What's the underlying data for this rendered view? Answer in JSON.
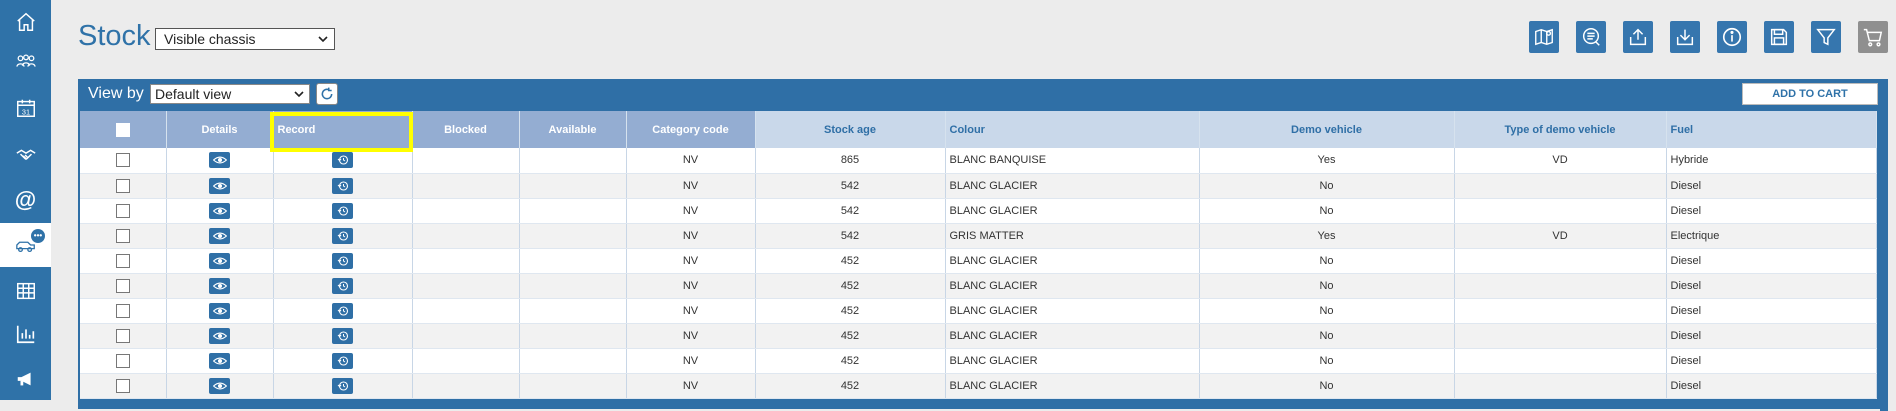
{
  "nav": {
    "items": [
      {
        "name": "home-icon"
      },
      {
        "name": "group-icon"
      },
      {
        "name": "calendar-icon",
        "text": "31"
      },
      {
        "name": "handshake-icon"
      },
      {
        "name": "at-icon",
        "text": "@"
      },
      {
        "name": "vehicles-icon",
        "badge": "•••",
        "active": true
      },
      {
        "name": "spreadsheet-icon"
      },
      {
        "name": "bar-chart-icon"
      },
      {
        "name": "megaphone-icon"
      }
    ]
  },
  "header": {
    "title": "Stock",
    "chassis_select": "Visible chassis"
  },
  "toolbar": [
    "map-pin-icon",
    "search-list-icon",
    "upload-icon",
    "download-icon",
    "info-icon",
    "save-icon",
    "filter-icon",
    "cart-icon"
  ],
  "panel": {
    "viewby_label": "View by",
    "viewby_select": "Default view",
    "add_to_cart": "ADD TO CART"
  },
  "table": {
    "columns": [
      "",
      "Details",
      "Record",
      "Blocked",
      "Available",
      "Category code",
      "Stock age",
      "Colour",
      "Demo vehicle",
      "Type of demo vehicle",
      "Fuel"
    ],
    "rows": [
      {
        "category": "NV",
        "age": "865",
        "colour": "BLANC BANQUISE",
        "demo": "Yes",
        "demo_type": "VD",
        "fuel": "Hybride"
      },
      {
        "category": "NV",
        "age": "542",
        "colour": "BLANC GLACIER",
        "demo": "No",
        "demo_type": "",
        "fuel": "Diesel"
      },
      {
        "category": "NV",
        "age": "542",
        "colour": "BLANC GLACIER",
        "demo": "No",
        "demo_type": "",
        "fuel": "Diesel"
      },
      {
        "category": "NV",
        "age": "542",
        "colour": "GRIS MATTER",
        "demo": "Yes",
        "demo_type": "VD",
        "fuel": "Electrique"
      },
      {
        "category": "NV",
        "age": "452",
        "colour": "BLANC GLACIER",
        "demo": "No",
        "demo_type": "",
        "fuel": "Diesel"
      },
      {
        "category": "NV",
        "age": "452",
        "colour": "BLANC GLACIER",
        "demo": "No",
        "demo_type": "",
        "fuel": "Diesel"
      },
      {
        "category": "NV",
        "age": "452",
        "colour": "BLANC GLACIER",
        "demo": "No",
        "demo_type": "",
        "fuel": "Diesel"
      },
      {
        "category": "NV",
        "age": "452",
        "colour": "BLANC GLACIER",
        "demo": "No",
        "demo_type": "",
        "fuel": "Diesel"
      },
      {
        "category": "NV",
        "age": "452",
        "colour": "BLANC GLACIER",
        "demo": "No",
        "demo_type": "",
        "fuel": "Diesel"
      },
      {
        "category": "NV",
        "age": "452",
        "colour": "BLANC GLACIER",
        "demo": "No",
        "demo_type": "",
        "fuel": "Diesel"
      }
    ]
  },
  "highlight_color": "#ffff00",
  "accent_color": "#2f72a8"
}
